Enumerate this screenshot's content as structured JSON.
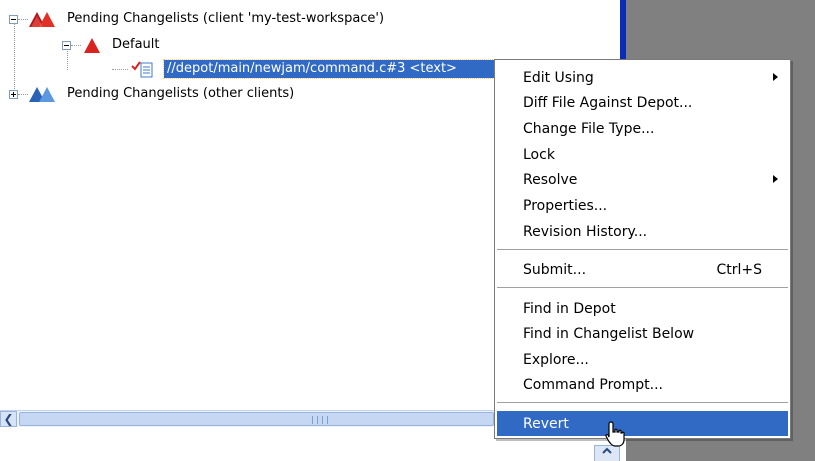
{
  "tree": {
    "nodes": [
      {
        "label": "Pending Changelists (client 'my-test-workspace')"
      },
      {
        "label": "Default"
      },
      {
        "label": "//depot/main/newjam/command.c#3 <text>"
      },
      {
        "label": "Pending Changelists (other clients)"
      }
    ]
  },
  "context_menu": {
    "items": [
      {
        "label": "Edit Using",
        "submenu": true
      },
      {
        "label": "Diff File Against Depot..."
      },
      {
        "label": "Change File Type..."
      },
      {
        "label": "Lock"
      },
      {
        "label": "Resolve",
        "submenu": true
      },
      {
        "label": "Properties..."
      },
      {
        "label": "Revision History..."
      },
      {
        "label": "Submit...",
        "shortcut": "Ctrl+S"
      },
      {
        "label": "Find in Depot"
      },
      {
        "label": "Find in Changelist Below"
      },
      {
        "label": "Explore..."
      },
      {
        "label": "Command Prompt..."
      },
      {
        "label": "Revert",
        "highlighted": true
      }
    ]
  },
  "colors": {
    "selection": "#316ac5",
    "pane_background": "#ffffff",
    "desktop_gray": "#808080",
    "icon_red": "#d9231f",
    "icon_blue": "#3f79c8"
  },
  "icons": [
    "collapse-icon",
    "expand-icon",
    "red-changelist-icon",
    "red-triangle-icon",
    "blue-changelist-icon",
    "text-file-icon",
    "submenu-arrow-icon",
    "scroll-left-icon",
    "mouse-pointer-icon"
  ]
}
